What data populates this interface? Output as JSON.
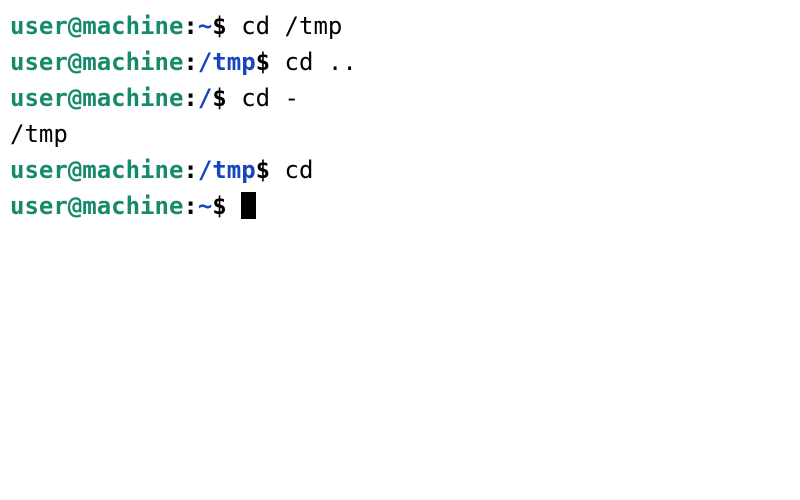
{
  "prompt": {
    "user_host": "user@machine",
    "colon": ":",
    "dollar": "$ "
  },
  "lines": [
    {
      "path": "~",
      "command": "cd /tmp"
    },
    {
      "path": "/tmp",
      "command": "cd .."
    },
    {
      "path": "/",
      "command": "cd -"
    },
    {
      "output": "/tmp"
    },
    {
      "path": "/tmp",
      "command": "cd"
    },
    {
      "path": "~",
      "command": "",
      "cursor": true
    }
  ]
}
